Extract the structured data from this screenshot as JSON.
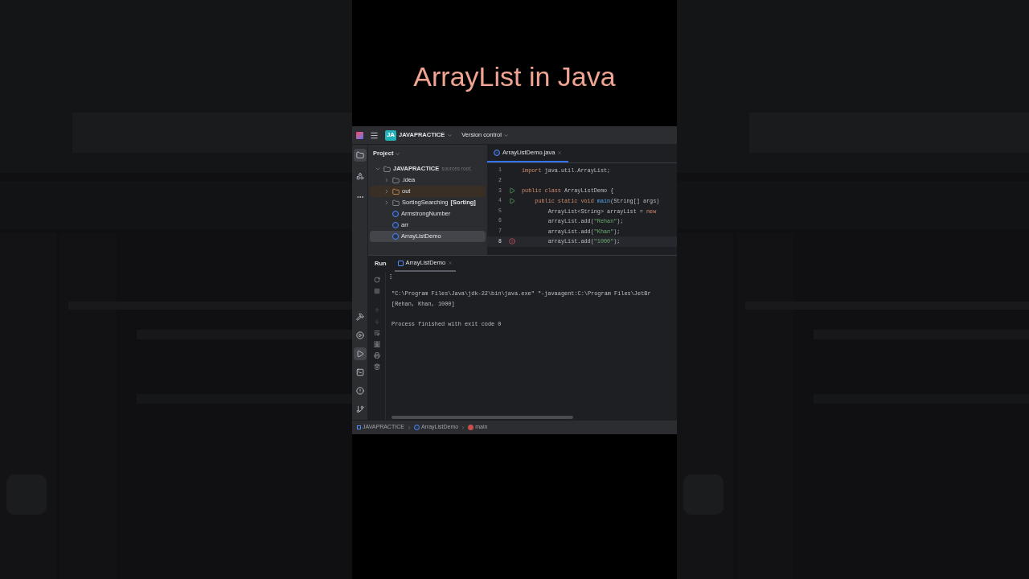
{
  "headline": "ArrayList in Java",
  "ide": {
    "toolbar": {
      "badge": "JA",
      "project": "JAVAPRACTICE",
      "vcs": "Version control"
    },
    "tool_windows_top": [
      {
        "kind": "folder",
        "selected": true
      },
      {
        "kind": "structure",
        "selected": false
      },
      {
        "kind": "more",
        "selected": false
      }
    ],
    "tool_windows_bottom": [
      {
        "kind": "build",
        "selected": false
      },
      {
        "kind": "services",
        "selected": false
      },
      {
        "kind": "run",
        "selected": true
      },
      {
        "kind": "terminal",
        "selected": false
      },
      {
        "kind": "problems",
        "selected": false
      },
      {
        "kind": "git",
        "selected": false
      }
    ],
    "project_panel": {
      "title": "Project",
      "tree": [
        {
          "label": "JAVAPRACTICE",
          "note": "sources root, ",
          "kind": "module",
          "expanded": true,
          "selected": false,
          "children": [
            {
              "label": ".idea",
              "kind": "folder",
              "expanded": false,
              "selected": false
            },
            {
              "label": "out",
              "kind": "excluded",
              "expanded": false,
              "selected": false
            },
            {
              "label": "SortingSearching",
              "tag": "[Sorting]",
              "kind": "module",
              "expanded": false,
              "selected": false
            },
            {
              "label": "ArmstrongNumber",
              "kind": "class",
              "selected": false
            },
            {
              "label": "arr",
              "kind": "class",
              "selected": false
            },
            {
              "label": "ArrayListDemo",
              "kind": "class",
              "selected": true
            }
          ]
        }
      ]
    },
    "editor": {
      "tabs": [
        {
          "label": "ArrayListDemo.java",
          "selected": true
        }
      ],
      "lines": [
        {
          "number": "1",
          "current": false,
          "tokens": [
            {
              "text": "import ",
              "kind": "keyword"
            },
            {
              "text": "java.util.ArrayList;",
              "kind": "plain"
            }
          ]
        },
        {
          "number": "2",
          "current": false
        },
        {
          "number": "3",
          "current": false,
          "run_marker": true,
          "tokens": [
            {
              "text": "public class ",
              "kind": "keyword"
            },
            {
              "text": "ArrayListDemo {",
              "kind": "plain"
            }
          ]
        },
        {
          "number": "4",
          "current": false,
          "run_marker": true,
          "tokens": [
            {
              "text": "    public static void ",
              "kind": "keyword"
            },
            {
              "text": "main",
              "kind": "function"
            },
            {
              "text": "(String[] args)",
              "kind": "plain"
            }
          ]
        },
        {
          "number": "5",
          "current": false,
          "tokens": [
            {
              "text": "        ArrayList<String> arrayList = ",
              "kind": "plain"
            },
            {
              "text": "new",
              "kind": "keyword"
            }
          ]
        },
        {
          "number": "6",
          "current": false,
          "tokens": [
            {
              "text": "        arrayList.add(",
              "kind": "plain"
            },
            {
              "text": "\"Rehan\"",
              "kind": "string"
            },
            {
              "text": ");",
              "kind": "plain"
            }
          ]
        },
        {
          "number": "7",
          "current": false,
          "tokens": [
            {
              "text": "        arrayList.add(",
              "kind": "plain"
            },
            {
              "text": "\"Khan\"",
              "kind": "string"
            },
            {
              "text": ");",
              "kind": "plain"
            }
          ]
        },
        {
          "number": "8",
          "current": true,
          "error_marker": true,
          "tokens": [
            {
              "text": "        arrayList.add(",
              "kind": "plain"
            },
            {
              "text": "\"1000\"",
              "kind": "string"
            },
            {
              "text": ");",
              "kind": "plain"
            }
          ]
        }
      ]
    },
    "run_panel": {
      "title": "Run",
      "tabs": [
        {
          "label": "ArrayListDemo",
          "selected": true
        }
      ],
      "output": [
        {
          "text": "\"C:\\Program Files\\Java\\jdk-22\\bin\\java.exe\" \"-javaagent:C:\\Program Files\\JetBr",
          "gap_before": false
        },
        {
          "text": "[Rehan, Khan, 1000]",
          "gap_before": false
        },
        {
          "text": "Process finished with exit code 0",
          "gap_before": true
        }
      ]
    },
    "breadcrumbs": [
      {
        "label": "JAVAPRACTICE",
        "kind": "module"
      },
      {
        "label": "ArrayListDemo",
        "kind": "class"
      },
      {
        "label": "main",
        "kind": "method"
      }
    ]
  }
}
